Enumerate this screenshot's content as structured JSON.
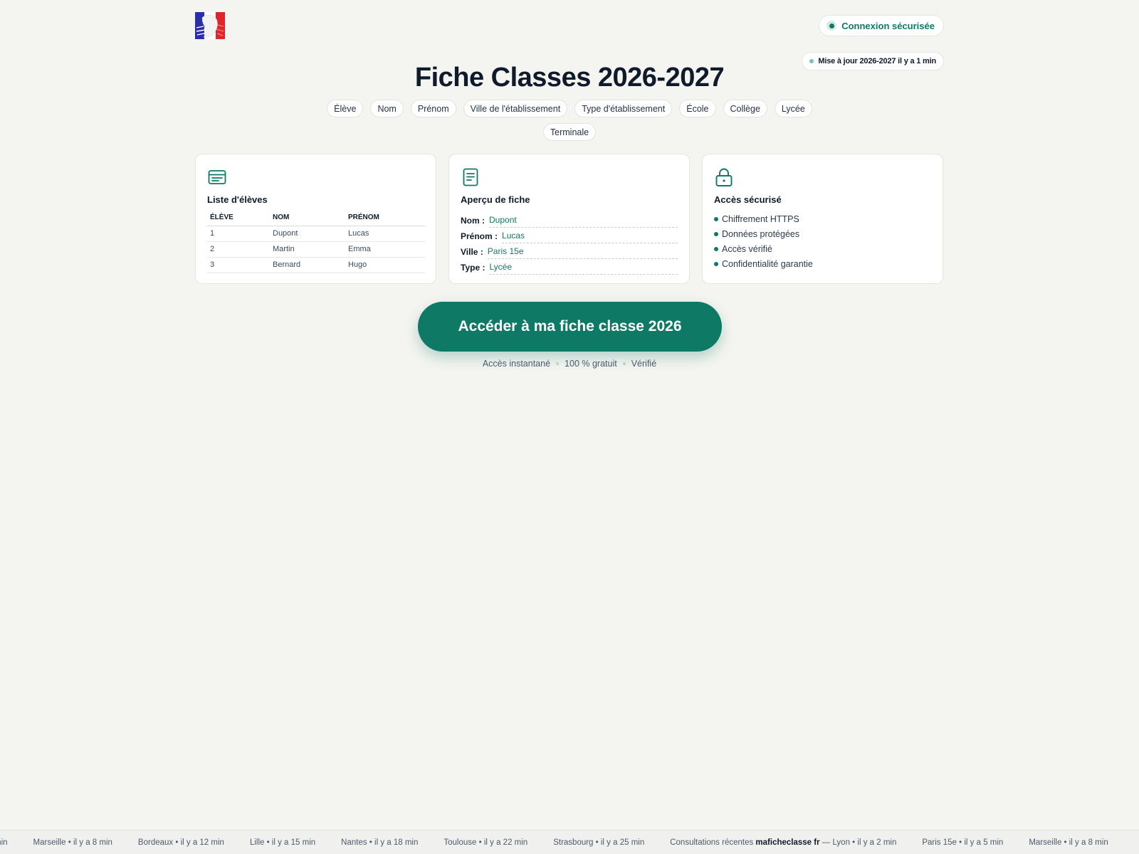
{
  "header": {
    "secure_label": "Connexion sécurisée",
    "update_label": "Mise à jour 2026-2027 il y a 1 min"
  },
  "page_title": "Fiche Classes 2026-2027",
  "chips": [
    "Élève",
    "Nom",
    "Prénom",
    "Ville de l'établissement",
    "Type d'établissement",
    "École",
    "Collège",
    "Lycée",
    "Terminale"
  ],
  "cards": {
    "students": {
      "icon": "list-card-icon",
      "title": "Liste d'élèves",
      "columns": [
        "ÉLÈVE",
        "NOM",
        "PRÉNOM"
      ],
      "rows": [
        [
          "1",
          "Dupont",
          "Lucas"
        ],
        [
          "2",
          "Martin",
          "Emma"
        ],
        [
          "3",
          "Bernard",
          "Hugo"
        ]
      ]
    },
    "preview": {
      "icon": "document-icon",
      "title": "Aperçu de fiche",
      "fields": [
        {
          "label": "Nom :",
          "value": "Dupont"
        },
        {
          "label": "Prénom :",
          "value": "Lucas"
        },
        {
          "label": "Ville :",
          "value": "Paris 15e"
        },
        {
          "label": "Type :",
          "value": "Lycée"
        }
      ]
    },
    "security": {
      "icon": "lock-icon",
      "title": "Accès sécurisé",
      "items": [
        "Chiffrement HTTPS",
        "Données protégées",
        "Accès vérifié",
        "Confidentialité garantie"
      ]
    }
  },
  "cta": {
    "label": "Accéder à ma fiche classe 2026",
    "meta": [
      "Accès instantané",
      "100 % gratuit",
      "Vérifié"
    ]
  },
  "ticker": {
    "lead_prefix": "Consultations récentes",
    "lead_brand": "maficheclasse fr",
    "lead_suffix": "— Lyon • il y a 2 min",
    "items": [
      "min",
      "Marseille • il y a 8 min",
      "Bordeaux • il y a 12 min",
      "Lille • il y a 15 min",
      "Nantes • il y a 18 min",
      "Toulouse • il y a 22 min",
      "Strasbourg • il y a 25 min"
    ],
    "tail": [
      "Paris 15e • il y a 5 min",
      "Marseille • il y a 8 min"
    ]
  },
  "colors": {
    "accent": "#0e7a66",
    "background": "#f4f4f0",
    "text": "#0f1a2a",
    "flag_blue": "#2a2fa8",
    "flag_red": "#e0242a"
  }
}
